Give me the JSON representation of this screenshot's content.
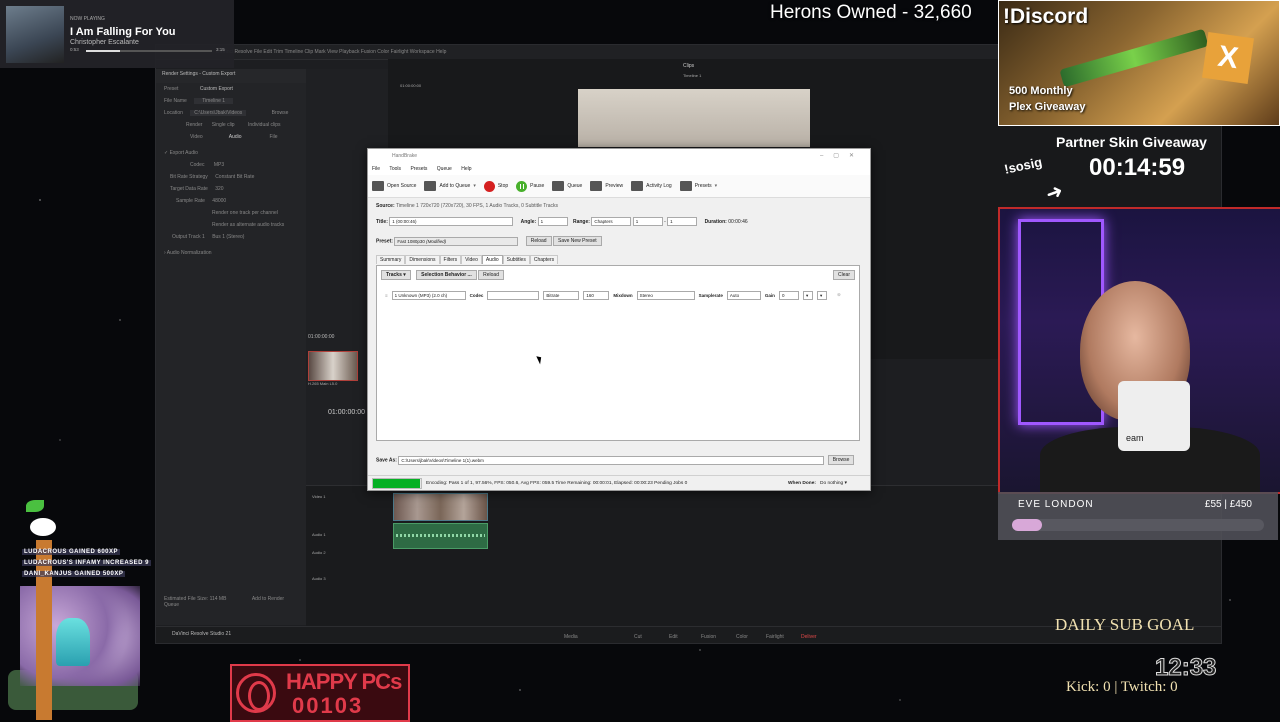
{
  "now_playing": {
    "label": "NOW PLAYING",
    "song": "I Am Falling For You",
    "artist": "Christopher Escalante",
    "time_elapsed": "0:53",
    "time_total": "3:15",
    "progress": 0.27
  },
  "herons": "Herons Owned - 32,660",
  "discord": {
    "title": "!Discord",
    "giveaway_line1": "500 Monthly",
    "giveaway_line2": "Plex Giveaway",
    "badge": "X"
  },
  "partner": {
    "title": "Partner Skin Giveaway",
    "timer": "00:14:59",
    "sosig": "!sosig"
  },
  "webcam": {
    "mug_text": "eam"
  },
  "eve_london": {
    "name": "EVE LONDON",
    "amount": "£55 | £450",
    "progress": 0.12
  },
  "daily_sub_goal": "DAILY SUB GOAL",
  "kick_twitch": "Kick: 0 | Twitch: 0",
  "clock": "12:33",
  "happy_pcs": {
    "line1": "HAPPY PCs",
    "line2": "00103"
  },
  "feed": [
    "LUDACROUS GAINED 600XP",
    "LUDACROUS'S INFAMY INCREASED 9",
    "DANI_KANJUS GAINED 500XP"
  ],
  "resolve": {
    "menu": "DaVinci Resolve  File  Edit  Trim  Timeline  Clip  Mark  View  Playback  Fusion  Color  Fairlight  Workspace  Help",
    "render_title": "Render Settings - Custom Export",
    "preset_label": "Preset",
    "preset_value": "Custom Export",
    "filename_label": "File Name",
    "filename_value": "Timeline 1",
    "location_label": "Location",
    "location_value": "C:\\Users\\Jbak\\Videos",
    "browse": "Browse",
    "render_label": "Render",
    "single_clip": "Single clip",
    "individual_clips": "Individual clips",
    "tabs": [
      "Video",
      "Audio",
      "File"
    ],
    "export_audio": "Export Audio",
    "codec_label": "Codec",
    "codec_value": "MP3",
    "bitrate_strategy_label": "Bit Rate Strategy",
    "bitrate_strategy_value": "Constant Bit Rate",
    "data_rate_label": "Target Data Rate",
    "data_rate_value": "320",
    "sample_rate_label": "Sample Rate",
    "sample_rate_value": "48000",
    "render_one_track": "Render one track per channel",
    "render_alt": "Render as alternate audio tracks",
    "output_track_label": "Output Track 1",
    "output_track_value": "Bus 1 (Stereo)",
    "audio_norm": "Audio Normalization",
    "file_size": "Estimated File Size: 114 MB",
    "add_queue": "Add to Render Queue",
    "clips": "Clips",
    "timeline_tab": "Timeline 1",
    "timecode1": "01:00:00:00",
    "timecode2": "01:00:00:00",
    "timecode3": "01:00:00:00",
    "clip_name": "H.265 Main L5.0",
    "app_name": "DaVinci Resolve Studio 21",
    "pages": [
      "Media",
      "Cut",
      "Edit",
      "Fusion",
      "Color",
      "Fairlight",
      "Deliver"
    ],
    "track_v1": "Video 1",
    "track_a1": "Audio 1",
    "track_a2": "Audio 2",
    "track_a3": "Audio 3"
  },
  "handbrake": {
    "title": "HandBrake",
    "menu": [
      "File",
      "Tools",
      "Presets",
      "Queue",
      "Help"
    ],
    "toolbar": {
      "open_source": "Open Source",
      "add_to_queue": "Add to Queue",
      "stop": "Stop",
      "pause": "Pause",
      "queue": "Queue",
      "preview": "Preview",
      "activity_log": "Activity Log",
      "presets": "Presets"
    },
    "source_label": "Source:",
    "source_value": "Timeline 1   720x720 (720x720), 30 FPS, 1 Audio Tracks, 0 Subtitle Tracks",
    "title_label": "Title:",
    "title_value": "1  (00:00:46)",
    "angle_label": "Angle:",
    "angle_value": "1",
    "range_label": "Range:",
    "range_value": "Chapters",
    "range_from": "1",
    "range_dash": "-",
    "range_to": "1",
    "duration_label": "Duration:",
    "duration_value": "00:00:46",
    "preset_label": "Preset:",
    "preset_value": "Fast 1080p30",
    "preset_mod": "(Modified)",
    "reload": "Reload",
    "save_new_preset": "Save New Preset",
    "tabs": [
      "Summary",
      "Dimensions",
      "Filters",
      "Video",
      "Audio",
      "Subtitles",
      "Chapters"
    ],
    "tracks_btn": "Tracks",
    "selection_behavior": "Selection Behavior ...",
    "reload2": "Reload",
    "clear": "Clear",
    "track": {
      "source": "1 Unknown (MP3) (2.0 ch)",
      "codec_label": "Codec",
      "codec_value": "",
      "bitrate_label": "Bitrate",
      "bitrate_value": "160",
      "mixdown_label": "Mixdown",
      "mixdown_value": "Stereo",
      "samplerate_label": "Samplerate",
      "samplerate_value": "Auto",
      "gain_label": "Gain",
      "gain_value": "0"
    },
    "save_as_label": "Save As:",
    "save_as_value": "C:\\Users\\jbak\\Videos\\Timeline 1(1).webm",
    "browse": "Browse",
    "status": "Encoding: Pass 1 of 1,  97.56%, FPS: 050.6,  Avg FPS: 059.5  Time Remaining: 00:00:01,  Elapsed: 00:00:23     Pending Jobs 0",
    "progress": 0.9756,
    "when_done_label": "When Done:",
    "when_done_value": "Do nothing"
  }
}
